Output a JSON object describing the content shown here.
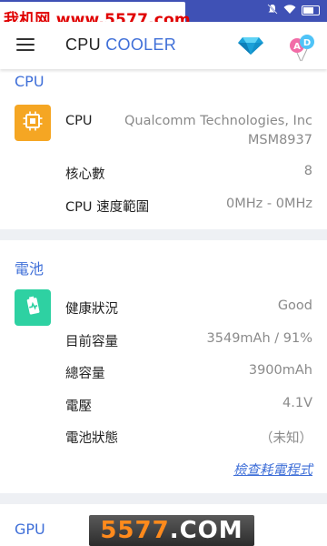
{
  "watermark": {
    "text": "我机网 www.5577.com"
  },
  "status_icons": [
    "mute-icon",
    "wifi-icon",
    "battery-icon"
  ],
  "app_bar": {
    "title_part1": "CPU",
    "title_part2": "COOLER",
    "icons": [
      "menu-icon",
      "diamond-icon",
      "ad-balloon-icon"
    ],
    "ad_letters": [
      "A",
      "D"
    ]
  },
  "cpu_section": {
    "title": "CPU",
    "rows": [
      {
        "label": "CPU",
        "value_line1": "Qualcomm Technologies, Inc",
        "value_line2": "MSM8937"
      },
      {
        "label": "核心數",
        "value": "8"
      },
      {
        "label": "CPU 速度範圍",
        "value": "0MHz - 0MHz"
      }
    ]
  },
  "battery_section": {
    "title": "電池",
    "rows": [
      {
        "label": "健康狀況",
        "value": "Good"
      },
      {
        "label": "目前容量",
        "value": "3549mAh / 91%"
      },
      {
        "label": "總容量",
        "value": "3900mAh"
      },
      {
        "label": "電壓",
        "value": "4.1V"
      },
      {
        "label": "電池狀態",
        "value": "（未知）"
      }
    ],
    "link": "檢查耗電程式"
  },
  "gpu_section": {
    "title": "GPU"
  },
  "bottom_watermark": {
    "prefix": "5577",
    "suffix": ".COM"
  },
  "colors": {
    "accent": "#3f6fd8",
    "status_bar": "#3f51b5",
    "cpu_badge": "#f5a623",
    "battery_badge": "#2ed1a2",
    "watermark_red": "#e00000"
  }
}
